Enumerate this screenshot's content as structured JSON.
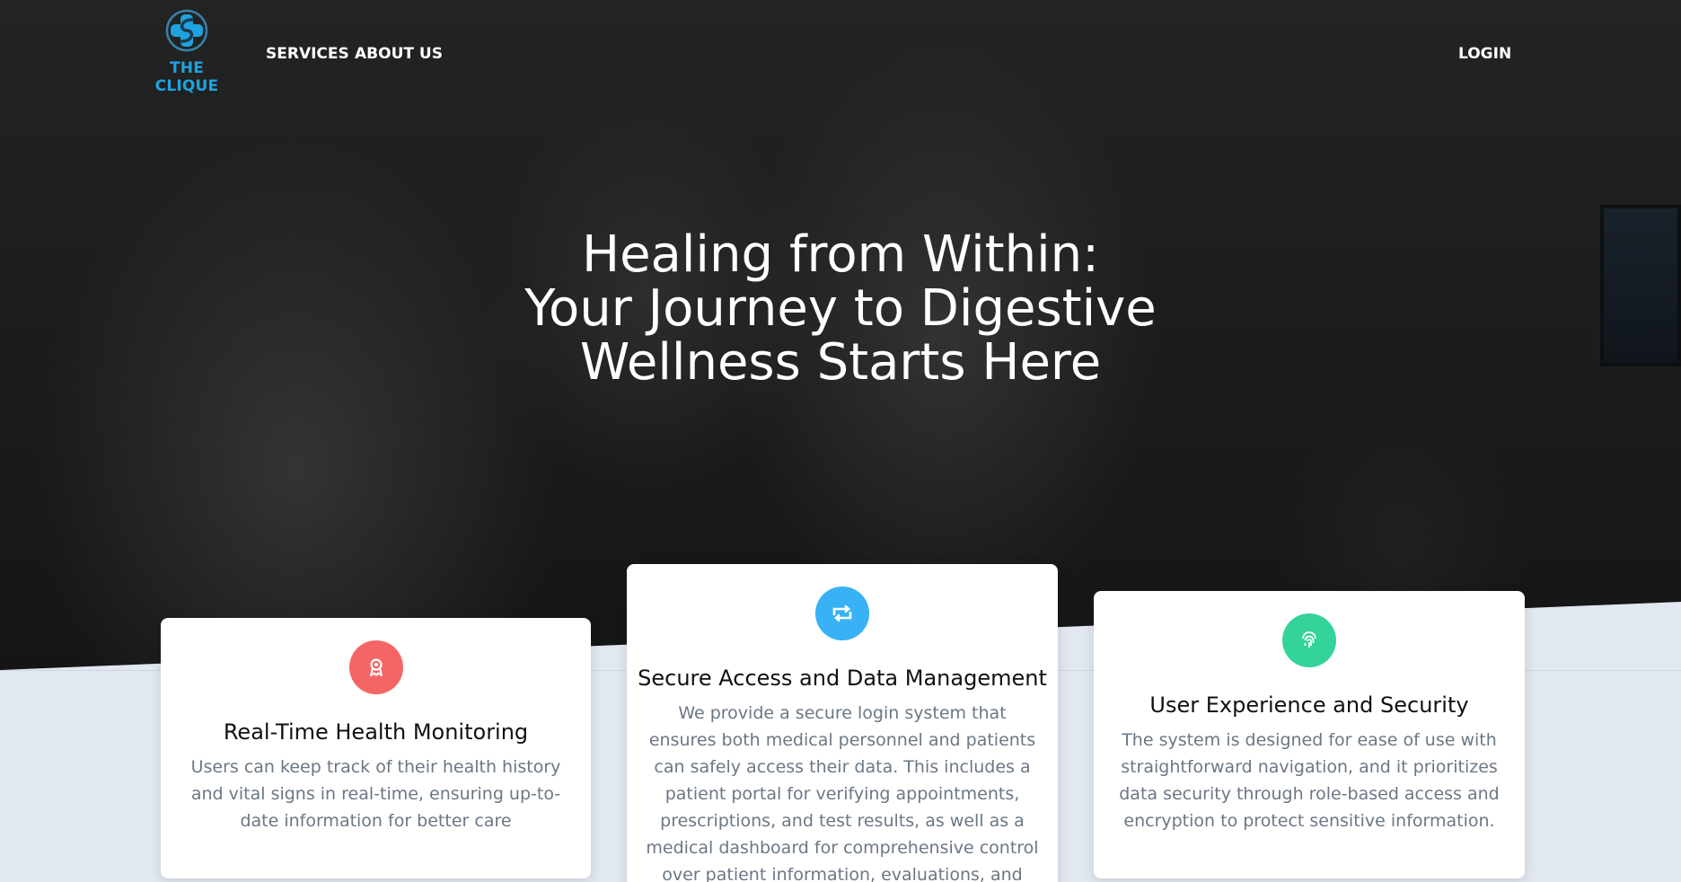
{
  "nav": {
    "logo_text": "THE CLIQUE",
    "links": [
      "SERVICES",
      "ABOUT US"
    ],
    "login": "LOGIN"
  },
  "hero": {
    "title_lines": [
      "Healing from Within:",
      "Your Journey to Digestive",
      "Wellness Starts Here"
    ]
  },
  "cards": [
    {
      "icon": "award-icon",
      "icon_color": "#f56565",
      "title": "Real-Time Health Monitoring",
      "text": "Users can keep track of their health history and vital signs in real-time, ensuring up-to-date information for better care"
    },
    {
      "icon": "retweet-icon",
      "icon_color": "#38b2f5",
      "title": "Secure Access and Data Management",
      "text": "We provide a secure login system that ensures both medical personnel and patients can safely access their data. This includes a patient portal for verifying appointments, prescriptions, and test results, as well as a medical dashboard for comprehensive control over patient information, evaluations, and therapies."
    },
    {
      "icon": "fingerprint-icon",
      "icon_color": "#34d399",
      "title": "User Experience and Security",
      "text": "The system is designed for ease of use with straightforward navigation, and it prioritizes data security through role-based access and encryption to protect sensitive information."
    }
  ],
  "colors": {
    "brand": "#1ea3e0",
    "section_bg": "#e2e8f0"
  }
}
